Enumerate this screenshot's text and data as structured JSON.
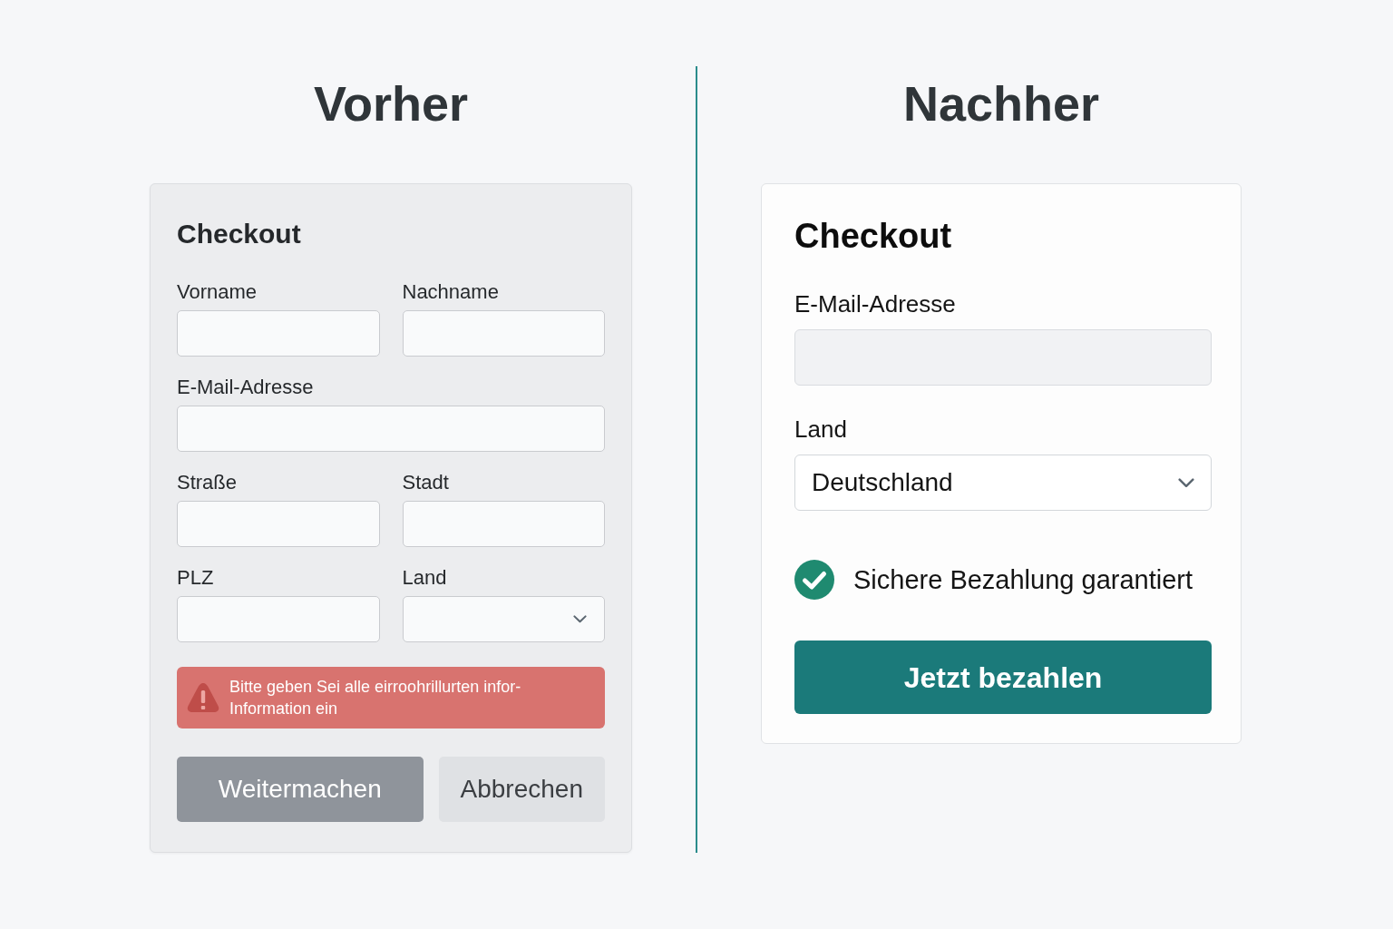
{
  "panels": [
    {
      "kind": "before",
      "heading": "Vorher",
      "form": {
        "title": "Checkout",
        "rows": [
          [
            {
              "label": "Vorname",
              "kind": "text"
            },
            {
              "label": "Nachname",
              "kind": "text"
            }
          ],
          [
            {
              "label": "E-Mail-Adresse",
              "kind": "text"
            }
          ],
          [
            {
              "label": "Straße",
              "kind": "text"
            },
            {
              "label": "Stadt",
              "kind": "text"
            }
          ],
          [
            {
              "label": "PLZ",
              "kind": "text"
            },
            {
              "label": "Land",
              "kind": "select"
            }
          ]
        ],
        "error": "Bitte geben Sei alle eirroohrillurten infor-\nInformation ein",
        "buttons": [
          {
            "label": "Weitermachen",
            "kind": "primary"
          },
          {
            "label": "Abbrechen",
            "kind": "secondary"
          }
        ]
      }
    },
    {
      "kind": "after",
      "heading": "Nachher",
      "form": {
        "title": "Checkout",
        "rows": [
          [
            {
              "label": "E-Mail-Adresse",
              "kind": "text"
            }
          ],
          [
            {
              "label": "Land",
              "kind": "select",
              "value": "Deutschland"
            }
          ]
        ],
        "assurance": "Sichere Bezahlung garantiert",
        "buttons": [
          {
            "label": "Jetzt bezahlen",
            "kind": "primary"
          }
        ]
      }
    }
  ]
}
